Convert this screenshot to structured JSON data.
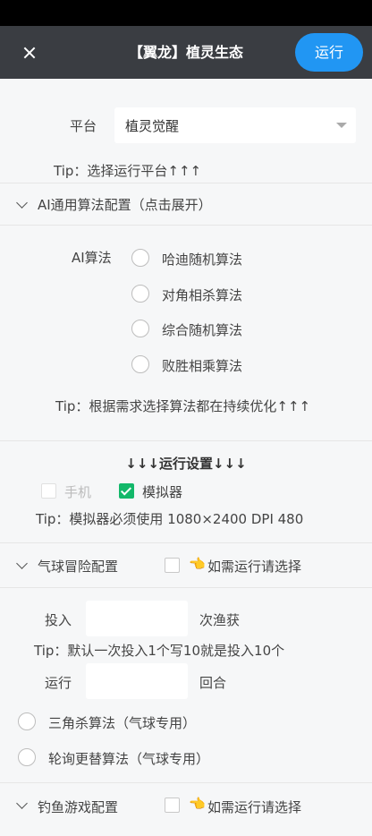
{
  "header": {
    "close_icon": "close-icon",
    "title": "【翼龙】植灵生态",
    "run_label": "运行"
  },
  "platform": {
    "label": "平台",
    "value": "植灵觉醒",
    "tip": "Tip：选择运行平台↑↑↑"
  },
  "ai_section": {
    "title": "AI通用算法配置（点击展开）",
    "algo_label": "AI算法",
    "options": [
      "哈迪随机算法",
      "对角相杀算法",
      "综合随机算法",
      "败胜相乘算法"
    ],
    "tip": "Tip：根据需求选择算法都在持续优化↑↑↑"
  },
  "run_settings": {
    "title": "↓↓↓运行设置↓↓↓",
    "phone_label": "手机",
    "phone_checked": false,
    "emulator_label": "模拟器",
    "emulator_checked": true,
    "tip": "Tip：模拟器必须使用 1080×2400 DPI 480"
  },
  "balloon": {
    "title": "气球冒险配置",
    "select_hint": "如需运行请选择",
    "hand_icon": "pointing-hand-icon",
    "invest_label": "投入",
    "invest_unit": "次渔获",
    "invest_tip": "Tip：默认一次投入1个写10就是投入10个",
    "rounds_label": "运行",
    "rounds_unit": "回合",
    "algos": [
      "三角杀算法（气球专用）",
      "轮询更替算法（气球专用）"
    ]
  },
  "fishing": {
    "title": "钓鱼游戏配置",
    "select_hint": "如需运行请选择"
  },
  "colors": {
    "header_bg": "#3a3d42",
    "accent": "#2196f3",
    "checked": "#13b86a"
  }
}
